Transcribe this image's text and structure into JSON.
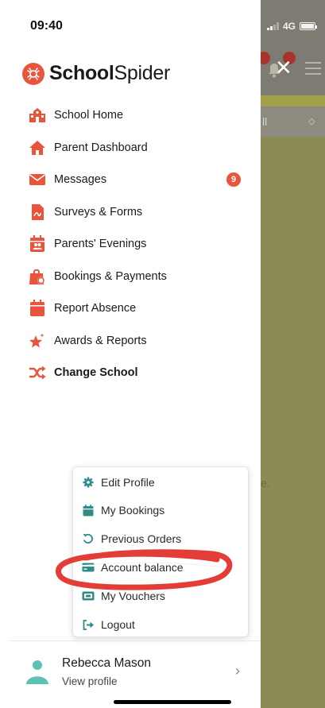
{
  "status_bar": {
    "time": "09:40",
    "network": "4G"
  },
  "brand": {
    "name_bold": "School",
    "name_light": "Spider",
    "accent": "#e9553c"
  },
  "nav": {
    "items": [
      {
        "label": "School Home",
        "icon": "school-icon"
      },
      {
        "label": "Parent Dashboard",
        "icon": "home-icon"
      },
      {
        "label": "Messages",
        "icon": "envelope-icon",
        "badge": "9"
      },
      {
        "label": "Surveys & Forms",
        "icon": "form-icon"
      },
      {
        "label": "Parents' Evenings",
        "icon": "calendar-people-icon"
      },
      {
        "label": "Bookings & Payments",
        "icon": "shopping-bag-icon"
      },
      {
        "label": "Report Absence",
        "icon": "calendar-icon"
      },
      {
        "label": "Awards & Reports",
        "icon": "star-award-icon"
      },
      {
        "label": "Change School",
        "icon": "shuffle-icon"
      }
    ]
  },
  "profile_menu": {
    "items": [
      {
        "label": "Edit Profile",
        "icon": "gear-icon"
      },
      {
        "label": "My Bookings",
        "icon": "calendar-icon"
      },
      {
        "label": "Previous Orders",
        "icon": "history-icon"
      },
      {
        "label": "Account balance",
        "icon": "credit-card-icon"
      },
      {
        "label": "My Vouchers",
        "icon": "voucher-icon"
      },
      {
        "label": "Logout",
        "icon": "logout-icon"
      }
    ]
  },
  "profile": {
    "name": "Rebecca Mason",
    "subtitle": "View profile"
  },
  "background": {
    "filter_text": "ll",
    "body_text": "e."
  },
  "colors": {
    "icon_teal": "#2f8c88",
    "annotation_red": "#e0332b"
  }
}
